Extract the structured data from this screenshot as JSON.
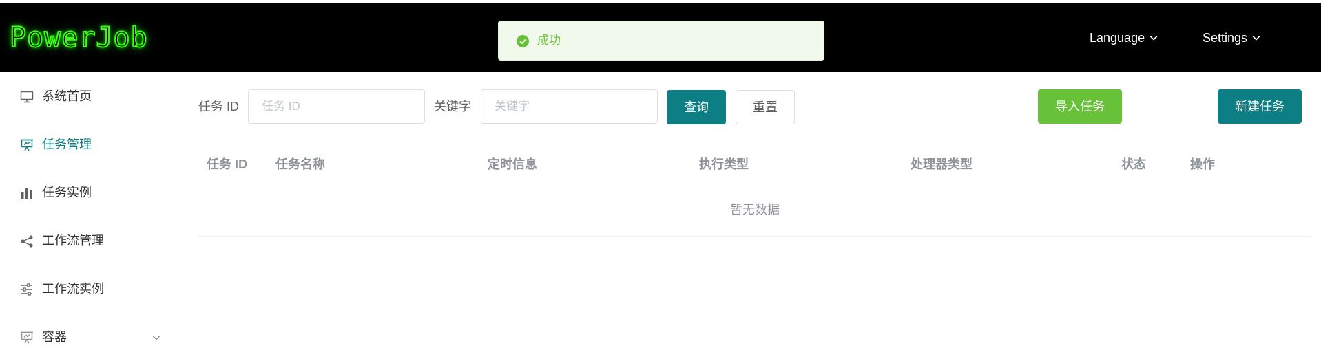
{
  "header": {
    "logo": "PowerJob",
    "language_label": "Language",
    "settings_label": "Settings"
  },
  "toast": {
    "message": "成功",
    "color": "#67c23a"
  },
  "sidebar": {
    "items": [
      {
        "label": "系统首页",
        "icon": "monitor-icon"
      },
      {
        "label": "任务管理",
        "icon": "presentation-board-icon",
        "active": true
      },
      {
        "label": "任务实例",
        "icon": "bar-chart-icon"
      },
      {
        "label": "工作流管理",
        "icon": "share-icon"
      },
      {
        "label": "工作流实例",
        "icon": "sliders-icon"
      },
      {
        "label": "容器",
        "icon": "presentation-board-icon",
        "expandable": true
      }
    ]
  },
  "search": {
    "task_id_label": "任务 ID",
    "task_id_placeholder": "任务 ID",
    "task_id_value": "",
    "keyword_label": "关键字",
    "keyword_placeholder": "关键字",
    "keyword_value": "",
    "query_button": "查询",
    "reset_button": "重置",
    "import_button": "导入任务",
    "new_button": "新建任务"
  },
  "table": {
    "columns": [
      "任务 ID",
      "任务名称",
      "定时信息",
      "执行类型",
      "处理器类型",
      "状态",
      "操作"
    ],
    "rows": [],
    "empty_text": "暂无数据"
  },
  "colors": {
    "primary": "#0d7e83",
    "success": "#67c23a",
    "header_bg": "#000000",
    "logo_glow": "#39ff14"
  }
}
